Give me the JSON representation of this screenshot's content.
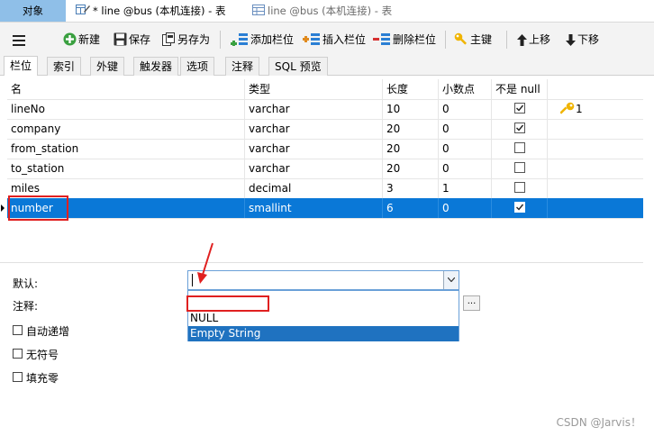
{
  "tabs": {
    "objects": "对象",
    "active_table": "* line @bus (本机连接) - 表",
    "other_table": "line @bus (本机连接) - 表"
  },
  "toolbar": {
    "new": "新建",
    "save": "保存",
    "save_as": "另存为",
    "add_field": "添加栏位",
    "insert_field": "插入栏位",
    "delete_field": "删除栏位",
    "primary_key": "主键",
    "move_up": "上移",
    "move_down": "下移"
  },
  "subtabs": [
    "栏位",
    "索引",
    "外键",
    "触发器",
    "选项",
    "注释",
    "SQL 预览"
  ],
  "grid": {
    "headers": [
      "名",
      "类型",
      "长度",
      "小数点",
      "不是 null"
    ],
    "rows": [
      {
        "name": "lineNo",
        "type": "varchar",
        "length": "10",
        "decimals": "0",
        "not_null": true,
        "key": "1"
      },
      {
        "name": "company",
        "type": "varchar",
        "length": "20",
        "decimals": "0",
        "not_null": true,
        "key": ""
      },
      {
        "name": "from_station",
        "type": "varchar",
        "length": "20",
        "decimals": "0",
        "not_null": false,
        "key": ""
      },
      {
        "name": "to_station",
        "type": "varchar",
        "length": "20",
        "decimals": "0",
        "not_null": false,
        "key": ""
      },
      {
        "name": "miles",
        "type": "decimal",
        "length": "3",
        "decimals": "1",
        "not_null": false,
        "key": ""
      },
      {
        "name": "number",
        "type": "smallint",
        "length": "6",
        "decimals": "0",
        "not_null": true,
        "key": ""
      }
    ]
  },
  "panel": {
    "default_label": "默认:",
    "comment_label": "注释:",
    "auto_increment": "自动递增",
    "unsigned": "无符号",
    "zerofill": "填充零",
    "default_value": "",
    "comment_button": "...",
    "dropdown_options": [
      "",
      "NULL",
      "Empty String"
    ]
  },
  "watermark": "CSDN @Jarvis！",
  "colors": {
    "selection": "#0a78d7",
    "annotation": "#e02020",
    "objects_tab": "#8fbfe8"
  }
}
